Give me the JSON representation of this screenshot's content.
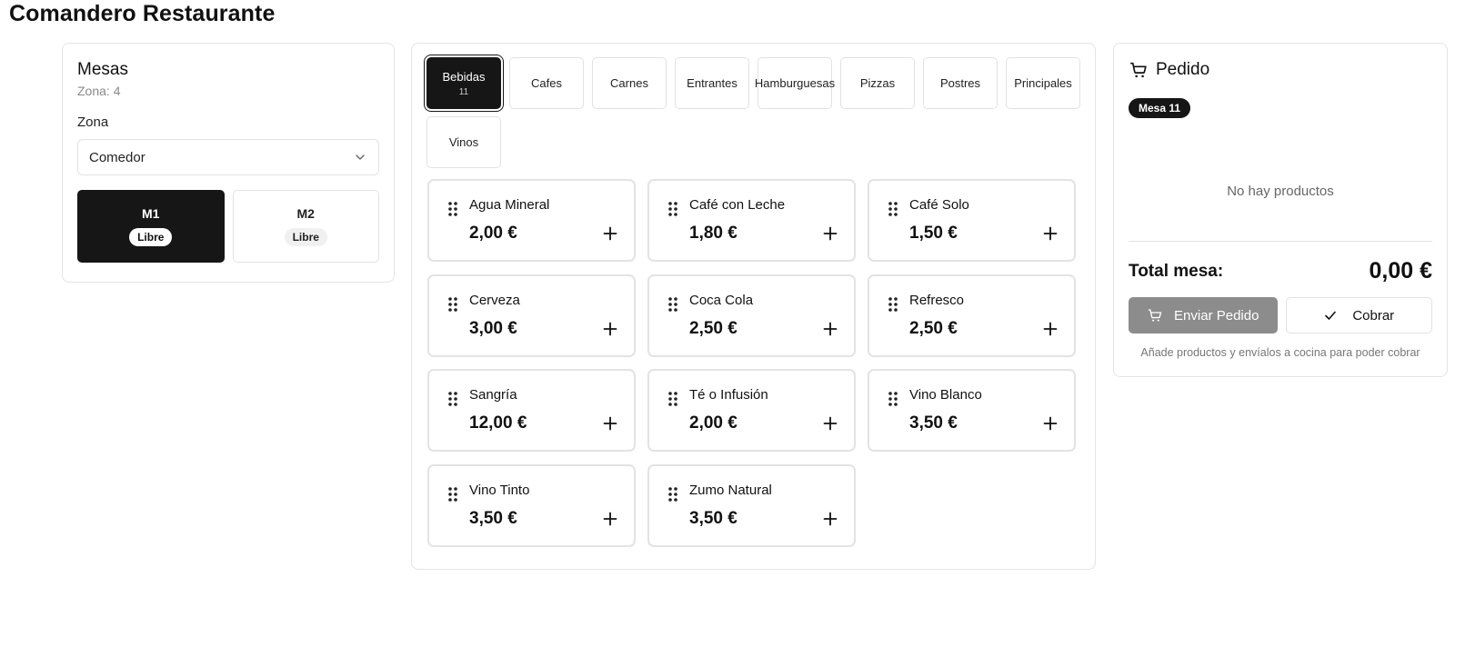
{
  "app": {
    "title": "Comandero Restaurante"
  },
  "mesas": {
    "title": "Mesas",
    "subtitle": "Zona: 4",
    "zona_label": "Zona",
    "zona_value": "Comedor",
    "tables": [
      {
        "name": "M1",
        "status": "Libre"
      },
      {
        "name": "M2",
        "status": "Libre"
      }
    ]
  },
  "categories": [
    {
      "label": "Bebidas",
      "count": "11"
    },
    {
      "label": "Cafes"
    },
    {
      "label": "Carnes"
    },
    {
      "label": "Entrantes"
    },
    {
      "label": "Hamburguesas"
    },
    {
      "label": "Pizzas"
    },
    {
      "label": "Postres"
    },
    {
      "label": "Principales"
    },
    {
      "label": "Vinos"
    }
  ],
  "products": [
    {
      "name": "Agua Mineral",
      "price": "2,00 €"
    },
    {
      "name": "Café con Leche",
      "price": "1,80 €"
    },
    {
      "name": "Café Solo",
      "price": "1,50 €"
    },
    {
      "name": "Cerveza",
      "price": "3,00 €"
    },
    {
      "name": "Coca Cola",
      "price": "2,50 €"
    },
    {
      "name": "Refresco",
      "price": "2,50 €"
    },
    {
      "name": "Sangría",
      "price": "12,00 €"
    },
    {
      "name": "Té o Infusión",
      "price": "2,00 €"
    },
    {
      "name": "Vino Blanco",
      "price": "3,50 €"
    },
    {
      "name": "Vino Tinto",
      "price": "3,50 €"
    },
    {
      "name": "Zumo Natural",
      "price": "3,50 €"
    }
  ],
  "pedido": {
    "title": "Pedido",
    "mesa_badge": "Mesa 11",
    "empty_text": "No hay productos",
    "total_label": "Total mesa:",
    "total_value": "0,00 €",
    "send_label": "Enviar Pedido",
    "cobrar_label": "Cobrar",
    "hint": "Añade productos y envíalos a cocina para poder cobrar"
  },
  "icons": {
    "cart": "shopping-cart-icon",
    "check": "check-icon",
    "plus": "plus-icon",
    "grip": "drag-handle-icon",
    "chevron": "chevron-down-icon"
  }
}
